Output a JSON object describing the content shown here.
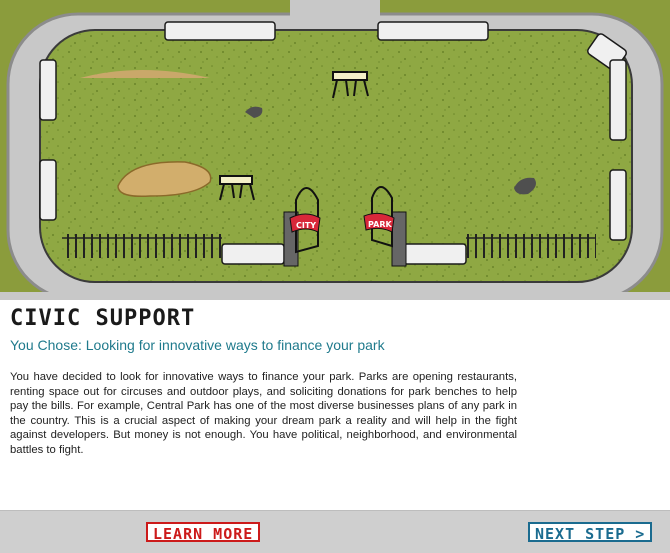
{
  "scene": {
    "description_icons": [
      "city-gate-icon",
      "park-gate-icon",
      "barricade-icon",
      "rock-icon",
      "dirt-pile-icon"
    ],
    "gate_left_sign": "CITY",
    "gate_right_sign": "PARK",
    "colors": {
      "grass": "#8ea840",
      "road": "#c9c9c9",
      "outer": "#8a9a3a"
    }
  },
  "content": {
    "title": "CIVIC SUPPORT",
    "subtitle": "You Chose: Looking for innovative ways to finance your park",
    "body": "You have decided to look for innovative ways to finance your park. Parks are opening restaurants, renting space out for circuses and outdoor plays, and soliciting donations for park benches to help pay the bills. For example, Central Park has one of the most diverse businesses plans of any park in the country. This is a crucial aspect of making your dream park a reality and will help in the fight against developers. But money is not enough. You have political, neighborhood, and environmental battles to fight."
  },
  "footer": {
    "learn_more_label": "LEARN MORE",
    "next_step_label": "NEXT STEP >",
    "colors": {
      "learn_more": "#cc1a1a",
      "next_step": "#1a6b8f"
    }
  }
}
